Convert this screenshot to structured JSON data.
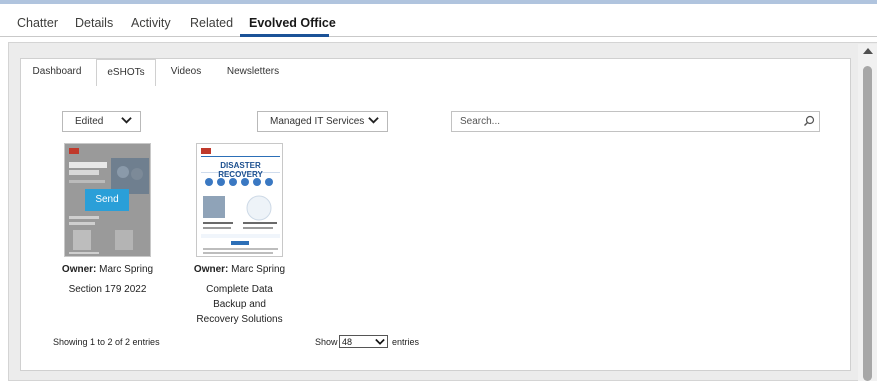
{
  "record_tabs": [
    {
      "label": "Chatter"
    },
    {
      "label": "Details"
    },
    {
      "label": "Activity"
    },
    {
      "label": "Related"
    },
    {
      "label": "Evolved Office"
    }
  ],
  "inner_tabs": [
    {
      "label": "Dashboard"
    },
    {
      "label": "eSHOTs"
    },
    {
      "label": "Videos"
    },
    {
      "label": "Newsletters"
    }
  ],
  "filters": {
    "status_value": "Edited",
    "category_value": "Managed IT Services",
    "search_placeholder": "Search..."
  },
  "cards": [
    {
      "owner_label": "Owner:",
      "owner_name": "Marc Spring",
      "title_lines": [
        "Section 179 2022"
      ],
      "action_label": "Send",
      "thumb_heading": "SECTION 179",
      "thumb_sub": "2022"
    },
    {
      "owner_label": "Owner:",
      "owner_name": "Marc Spring",
      "title_lines": [
        "Complete Data",
        "Backup and",
        "Recovery Solutions"
      ],
      "thumb_heading": "DISASTER RECOVERY"
    }
  ],
  "footer": {
    "info": "Showing 1 to 2 of 2 entries",
    "show_label": "Show",
    "show_value": "48",
    "entries_label": "entries"
  },
  "colors": {
    "active_tab_underline": "#1b5297",
    "send_button": "#2a9fd8",
    "frame_bg": "#ececec"
  }
}
